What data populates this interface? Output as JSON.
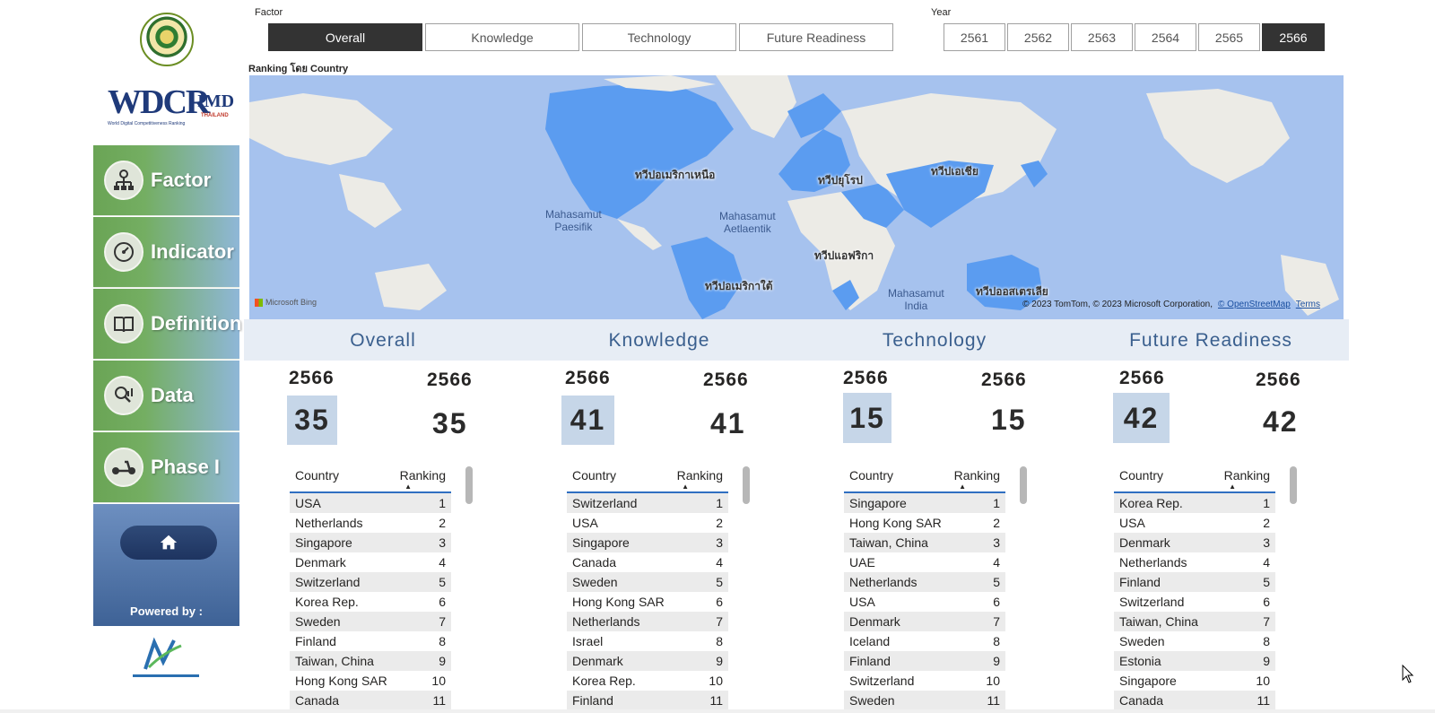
{
  "sidebar": {
    "menu": [
      {
        "label": "Factor",
        "icon": "hierarchy-icon"
      },
      {
        "label": "Indicator",
        "icon": "gauge-icon"
      },
      {
        "label": "Definition",
        "icon": "book-icon"
      },
      {
        "label": "Data",
        "icon": "data-analysis-icon"
      },
      {
        "label": "Phase I",
        "icon": "scooter-icon"
      }
    ],
    "logo_text": "WDCR",
    "logo_imd": "IMD",
    "logo_thailand": "THAILAND",
    "logo_subtitle": "World Digital Competitiveness Ranking",
    "powered_by": "Powered by :"
  },
  "factor_slicer": {
    "title": "Factor",
    "options": [
      "Overall",
      "Knowledge",
      "Technology",
      "Future Readiness"
    ],
    "selected": "Overall"
  },
  "year_slicer": {
    "title": "Year",
    "options": [
      "2561",
      "2562",
      "2563",
      "2564",
      "2565",
      "2566"
    ],
    "selected": "2566"
  },
  "map": {
    "title": "Ranking โดย Country",
    "continents": [
      "ทวีปอเมริกาเหนือ",
      "ทวีปยุโรป",
      "ทวีปเอเชีย",
      "ทวีปแอฟริกา",
      "ทวีปอเมริกาใต้",
      "ทวีปออสเตรเลีย"
    ],
    "oceans": [
      [
        "Mahasamut",
        "Paesifik"
      ],
      [
        "Mahasamut",
        "Aetlaentik"
      ],
      [
        "Mahasamut",
        "India"
      ]
    ],
    "bing": "Microsoft Bing",
    "attribution": "© 2023 TomTom, © 2023 Microsoft Corporation,",
    "osm": "© OpenStreetMap",
    "terms": "Terms",
    "colors": {
      "ocean": "#a6c2ee",
      "land": "#ecebe6",
      "highlight": "#5b9cf0"
    }
  },
  "sections": [
    {
      "title": "Overall",
      "year_a": "2566",
      "year_b": "2566",
      "rank_a": "35",
      "rank_b": "35",
      "col_country": "Country",
      "col_ranking": "Ranking",
      "rows": [
        [
          "USA",
          "1"
        ],
        [
          "Netherlands",
          "2"
        ],
        [
          "Singapore",
          "3"
        ],
        [
          "Denmark",
          "4"
        ],
        [
          "Switzerland",
          "5"
        ],
        [
          "Korea Rep.",
          "6"
        ],
        [
          "Sweden",
          "7"
        ],
        [
          "Finland",
          "8"
        ],
        [
          "Taiwan, China",
          "9"
        ],
        [
          "Hong Kong SAR",
          "10"
        ],
        [
          "Canada",
          "11"
        ]
      ]
    },
    {
      "title": "Knowledge",
      "year_a": "2566",
      "year_b": "2566",
      "rank_a": "41",
      "rank_b": "41",
      "col_country": "Country",
      "col_ranking": "Ranking",
      "rows": [
        [
          "Switzerland",
          "1"
        ],
        [
          "USA",
          "2"
        ],
        [
          "Singapore",
          "3"
        ],
        [
          "Canada",
          "4"
        ],
        [
          "Sweden",
          "5"
        ],
        [
          "Hong Kong SAR",
          "6"
        ],
        [
          "Netherlands",
          "7"
        ],
        [
          "Israel",
          "8"
        ],
        [
          "Denmark",
          "9"
        ],
        [
          "Korea Rep.",
          "10"
        ],
        [
          "Finland",
          "11"
        ]
      ]
    },
    {
      "title": "Technology",
      "year_a": "2566",
      "year_b": "2566",
      "rank_a": "15",
      "rank_b": "15",
      "col_country": "Country",
      "col_ranking": "Ranking",
      "rows": [
        [
          "Singapore",
          "1"
        ],
        [
          "Hong Kong SAR",
          "2"
        ],
        [
          "Taiwan, China",
          "3"
        ],
        [
          "UAE",
          "4"
        ],
        [
          "Netherlands",
          "5"
        ],
        [
          "USA",
          "6"
        ],
        [
          "Denmark",
          "7"
        ],
        [
          "Iceland",
          "8"
        ],
        [
          "Finland",
          "9"
        ],
        [
          "Switzerland",
          "10"
        ],
        [
          "Sweden",
          "11"
        ]
      ]
    },
    {
      "title": "Future Readiness",
      "year_a": "2566",
      "year_b": "2566",
      "rank_a": "42",
      "rank_b": "42",
      "col_country": "Country",
      "col_ranking": "Ranking",
      "rows": [
        [
          "Korea Rep.",
          "1"
        ],
        [
          "USA",
          "2"
        ],
        [
          "Denmark",
          "3"
        ],
        [
          "Netherlands",
          "4"
        ],
        [
          "Finland",
          "5"
        ],
        [
          "Switzerland",
          "6"
        ],
        [
          "Taiwan, China",
          "7"
        ],
        [
          "Sweden",
          "8"
        ],
        [
          "Estonia",
          "9"
        ],
        [
          "Singapore",
          "10"
        ],
        [
          "Canada",
          "11"
        ]
      ]
    }
  ]
}
